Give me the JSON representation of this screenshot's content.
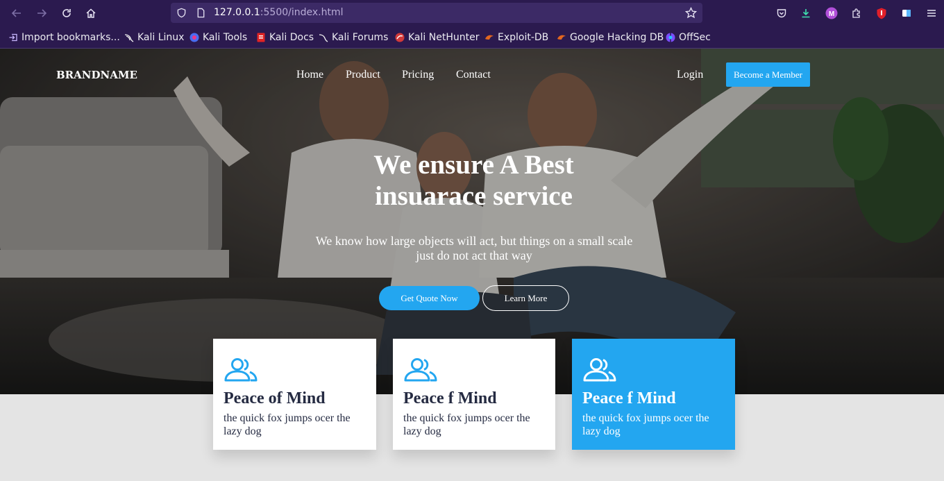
{
  "browser": {
    "url_host": "127.0.0.1",
    "url_path": ":5500/index.html",
    "bookmarks": [
      {
        "label": "Import bookmarks...",
        "icon": "import-icon",
        "color": "#c9b8ff"
      },
      {
        "label": "Kali Linux",
        "icon": "kali-dragon-icon",
        "color": "#1b1b1b"
      },
      {
        "label": "Kali Tools",
        "icon": "kali-tools-icon",
        "color": "#e8388a"
      },
      {
        "label": "Kali Docs",
        "icon": "kali-docs-icon",
        "color": "#e02424"
      },
      {
        "label": "Kali Forums",
        "icon": "kali-forums-icon",
        "color": "#1b1b1b"
      },
      {
        "label": "Kali NetHunter",
        "icon": "nethunter-icon",
        "color": "#d23a3a"
      },
      {
        "label": "Exploit-DB",
        "icon": "exploit-db-icon",
        "color": "#e2661f"
      },
      {
        "label": "Google Hacking DB",
        "icon": "ghdb-icon",
        "color": "#e2661f"
      },
      {
        "label": "OffSec",
        "icon": "offsec-icon",
        "color": "#7b4dff"
      }
    ]
  },
  "header": {
    "brand": "BRANDNAME",
    "nav": [
      "Home",
      "Product",
      "Pricing",
      "Contact"
    ],
    "login": "Login",
    "cta": "Become a Member"
  },
  "hero": {
    "title_line1": "We ensure A Best",
    "title_line2": "insuarace service",
    "subtitle": "We know how large objects will act, but things on a small scale just do not act that way",
    "primary_button": "Get Quote Now",
    "secondary_button": "Learn More"
  },
  "features": [
    {
      "title": "Peace of Mind",
      "text": "the quick fox jumps ocer the lazy dog",
      "icon": "users-icon"
    },
    {
      "title": "Peace f Mind",
      "text": "the quick fox jumps ocer the lazy dog",
      "icon": "users-icon"
    },
    {
      "title": "Peace f Mind",
      "text": "the quick fox jumps ocer the lazy dog",
      "icon": "users-icon"
    }
  ],
  "colors": {
    "accent": "#23a6f0",
    "text_dark": "#252b42",
    "browser_bg": "#2b1a4f"
  }
}
